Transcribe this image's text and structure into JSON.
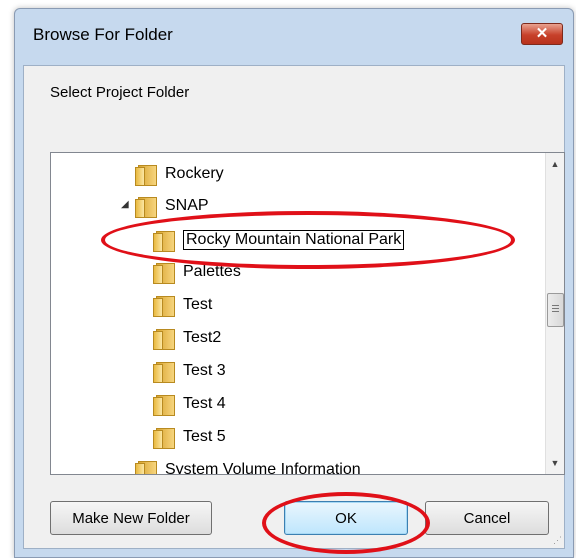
{
  "dialog": {
    "title": "Browse For Folder",
    "close_icon": "close-icon",
    "prompt": "Select Project Folder",
    "tree": [
      {
        "label": "Rockery",
        "expanded": null
      },
      {
        "label": "SNAP",
        "expanded": true
      },
      {
        "label": "Rocky Mountain National Park",
        "editing": true
      },
      {
        "label": "Palettes"
      },
      {
        "label": "Test"
      },
      {
        "label": "Test2"
      },
      {
        "label": "Test 3"
      },
      {
        "label": "Test 4"
      },
      {
        "label": "Test 5"
      },
      {
        "label": "System Volume Information"
      }
    ],
    "buttons": {
      "new_folder": "Make New Folder",
      "ok": "OK",
      "cancel": "Cancel"
    }
  },
  "colors": {
    "annotation": "#e01018",
    "ok_button": "#bee6fd",
    "titlebar": "#c6d9ee"
  }
}
